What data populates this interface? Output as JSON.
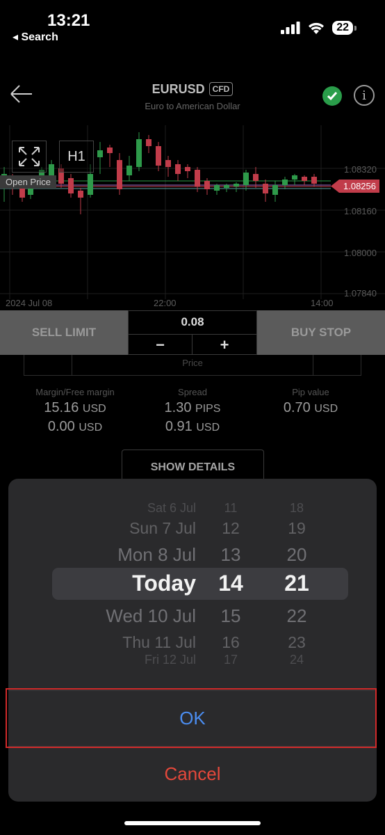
{
  "status_bar": {
    "time": "13:21",
    "back_label": "◂ Search",
    "battery": "22"
  },
  "header": {
    "symbol": "EURUSD",
    "badge": "CFD",
    "subtitle": "Euro to American Dollar"
  },
  "chart": {
    "timeframe": "H1",
    "open_price_label": "Open Price",
    "current_price": "1.08256",
    "price_labels": [
      "1.08320",
      "1.08160",
      "1.08000",
      "1.07840"
    ],
    "date_labels": [
      "2024 Jul 08",
      "22:00",
      "14:00"
    ],
    "colors": {
      "up": "#2e9a4a",
      "down": "#c13c4a"
    }
  },
  "order": {
    "sell_label": "SELL LIMIT",
    "buy_label": "BUY STOP",
    "volume": "0.08",
    "minus": "−",
    "plus": "+",
    "price_label": "Price"
  },
  "stats": {
    "margin": {
      "label": "Margin/Free margin",
      "value1": "15.16",
      "unit1": "USD",
      "value2": "0.00",
      "unit2": "USD"
    },
    "spread": {
      "label": "Spread",
      "value1": "1.30",
      "unit1": "PIPS",
      "value2": "0.91",
      "unit2": "USD"
    },
    "pip": {
      "label": "Pip value",
      "value1": "0.70",
      "unit1": "USD"
    }
  },
  "details_button": "SHOW DETAILS",
  "date_picker": {
    "rows": [
      {
        "day": "Sat 6 Jul",
        "hour": "11",
        "minute": "18"
      },
      {
        "day": "Sun 7 Jul",
        "hour": "12",
        "minute": "19"
      },
      {
        "day": "Mon 8 Jul",
        "hour": "13",
        "minute": "20"
      },
      {
        "day": "Today",
        "hour": "14",
        "minute": "21"
      },
      {
        "day": "Wed 10 Jul",
        "hour": "15",
        "minute": "22"
      },
      {
        "day": "Thu 11 Jul",
        "hour": "16",
        "minute": "23"
      },
      {
        "day": "Fri 12 Jul",
        "hour": "17",
        "minute": "24"
      }
    ],
    "ok_label": "OK",
    "cancel_label": "Cancel"
  }
}
